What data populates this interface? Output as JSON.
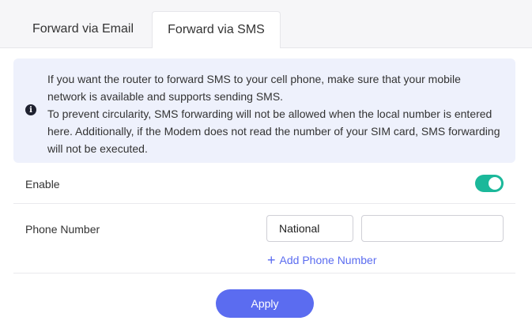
{
  "tabs": [
    {
      "label": "Forward via Email",
      "active": false
    },
    {
      "label": "Forward via SMS",
      "active": true
    }
  ],
  "notice": {
    "icon": "info-icon",
    "line1": "If you want the router to forward SMS to your cell phone, make sure that your mobile network is available and supports sending SMS.",
    "line2": "To prevent circularity, SMS forwarding will not be allowed when the local number is entered here. Additionally, if the Modem does not read the number of your SIM card, SMS forwarding will not be executed."
  },
  "enable": {
    "label": "Enable",
    "value": true
  },
  "phone": {
    "label": "Phone Number",
    "type_selected": "National",
    "number_value": "",
    "add_label": "Add Phone Number"
  },
  "apply_label": "Apply",
  "colors": {
    "accent": "#5b6cf0",
    "toggle_on": "#1bb89a",
    "notice_bg": "#eef1fc"
  }
}
